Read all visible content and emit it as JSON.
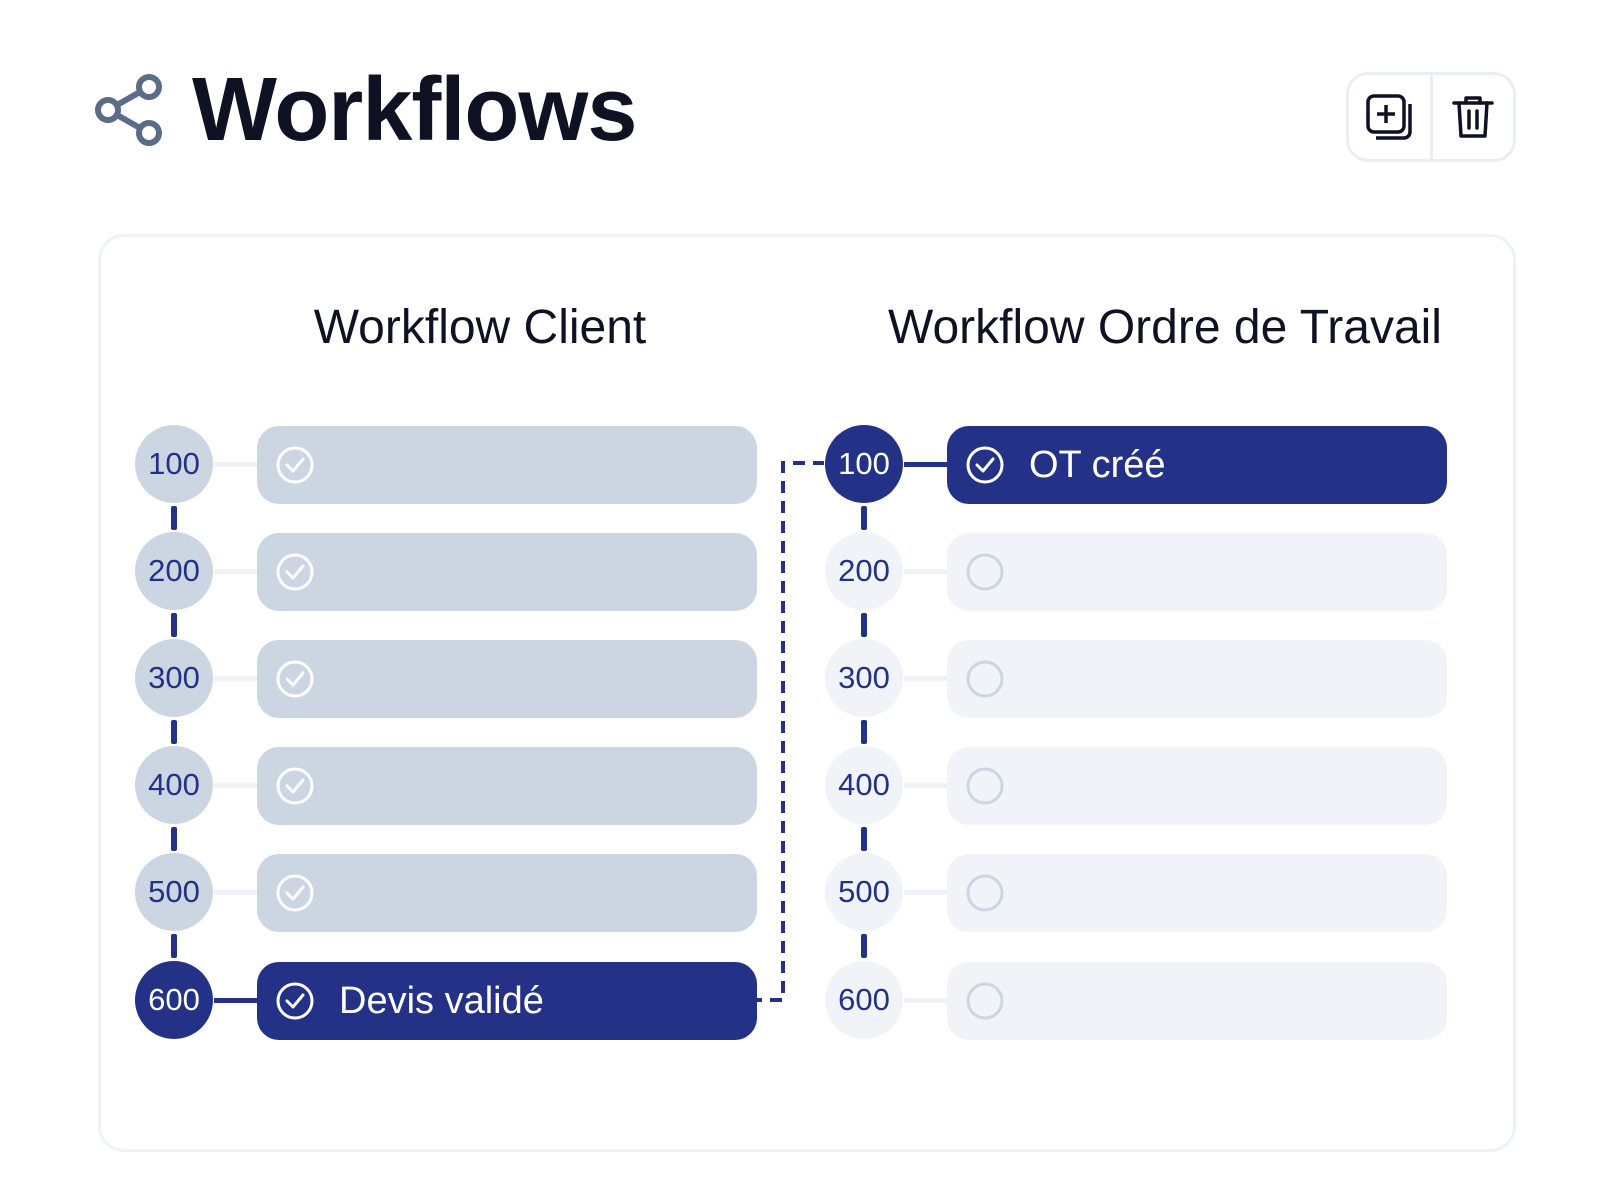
{
  "header": {
    "title": "Workflows",
    "icon": "share-icon",
    "actions": [
      {
        "name": "duplicate-button",
        "icon": "duplicate-icon"
      },
      {
        "name": "delete-button",
        "icon": "trash-icon"
      }
    ]
  },
  "workflows": [
    {
      "title": "Workflow Client",
      "steps": [
        {
          "number": "100",
          "label": "",
          "state": "done"
        },
        {
          "number": "200",
          "label": "",
          "state": "done"
        },
        {
          "number": "300",
          "label": "",
          "state": "done"
        },
        {
          "number": "400",
          "label": "",
          "state": "done"
        },
        {
          "number": "500",
          "label": "",
          "state": "done"
        },
        {
          "number": "600",
          "label": "Devis validé",
          "state": "active"
        }
      ]
    },
    {
      "title": "Workflow Ordre de Travail",
      "steps": [
        {
          "number": "100",
          "label": "OT créé",
          "state": "active"
        },
        {
          "number": "200",
          "label": "",
          "state": "pending"
        },
        {
          "number": "300",
          "label": "",
          "state": "pending"
        },
        {
          "number": "400",
          "label": "",
          "state": "pending"
        },
        {
          "number": "500",
          "label": "",
          "state": "pending"
        },
        {
          "number": "600",
          "label": "",
          "state": "pending"
        }
      ]
    }
  ],
  "colors": {
    "accent": "#233286",
    "done": "#cbd6e2",
    "pending": "#f0f3f8",
    "text": "#0f1222"
  }
}
